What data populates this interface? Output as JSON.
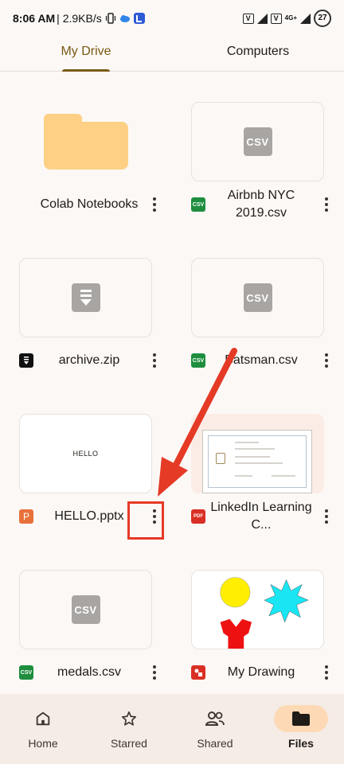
{
  "status_bar": {
    "time": "8:06 AM",
    "speed": "| 2.9KB/s",
    "network_label": "4G+",
    "battery": "27",
    "carrier_badge": "V"
  },
  "tabs": [
    {
      "label": "My Drive",
      "active": true
    },
    {
      "label": "Computers",
      "active": false
    }
  ],
  "files": [
    {
      "name": "Colab Notebooks",
      "type": "folder",
      "icon": "folder-icon"
    },
    {
      "name": "Airbnb NYC 2019.csv",
      "type": "csv",
      "icon_text": "CSV",
      "thumb_text": "CSV"
    },
    {
      "name": "archive.zip",
      "type": "zip"
    },
    {
      "name": "Batsman.csv",
      "type": "csv",
      "icon_text": "CSV",
      "thumb_text": "CSV"
    },
    {
      "name": "HELLO.pptx",
      "type": "ppt",
      "icon_text": "P",
      "thumb_text": "HELLO"
    },
    {
      "name": "LinkedIn Learning C...",
      "type": "pdf",
      "icon_text": "PDF"
    },
    {
      "name": "medals.csv",
      "type": "csv",
      "icon_text": "CSV",
      "thumb_text": "CSV"
    },
    {
      "name": "My Drawing",
      "type": "drawing"
    }
  ],
  "bottom_nav": [
    {
      "label": "Home",
      "icon": "home-icon",
      "active": false
    },
    {
      "label": "Starred",
      "icon": "star-icon",
      "active": false
    },
    {
      "label": "Shared",
      "icon": "people-icon",
      "active": false
    },
    {
      "label": "Files",
      "icon": "folder-icon",
      "active": true
    }
  ],
  "colors": {
    "accent": "#7a5a14",
    "annotation": "#e53a26",
    "folder": "#fdd085",
    "nav_active_bg": "#fdd9b5"
  }
}
